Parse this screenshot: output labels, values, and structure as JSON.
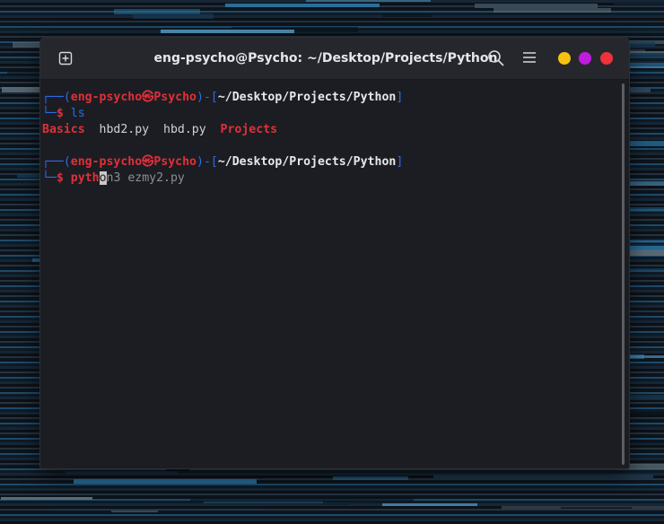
{
  "window": {
    "title": "eng-psycho@Psycho: ~/Desktop/Projects/Python",
    "icons": {
      "new_tab": "plus-icon",
      "search": "search-icon",
      "menu": "hamburger-menu-icon"
    },
    "controls_colors": {
      "minimize": "#f5c211",
      "maximize": "#c01cde",
      "close": "#ed333b"
    }
  },
  "terminal": {
    "prompt1": {
      "open": "┌──(",
      "user": "eng-psycho",
      "at": "㉿",
      "host": "Psycho",
      "close_paren": ")-[",
      "path": "~/Desktop/Projects/Python",
      "close_bracket": "]",
      "second_prefix": "└─",
      "dollar": "$",
      "command": "ls"
    },
    "ls_output": [
      {
        "name": "Basics",
        "type": "dir"
      },
      {
        "name": "hbd2.py",
        "type": "file"
      },
      {
        "name": "hbd.py",
        "type": "file"
      },
      {
        "name": "Projects",
        "type": "dir"
      }
    ],
    "prompt2": {
      "open": "┌──(",
      "user": "eng-psycho",
      "at": "㉿",
      "host": "Psycho",
      "close_paren": ")-[",
      "path": "~/Desktop/Projects/Python",
      "close_bracket": "]",
      "second_prefix": "└─",
      "dollar": "$",
      "typed": "pyth",
      "cursor_char": "o",
      "suggestion": "n3 ezmy2.py"
    }
  }
}
